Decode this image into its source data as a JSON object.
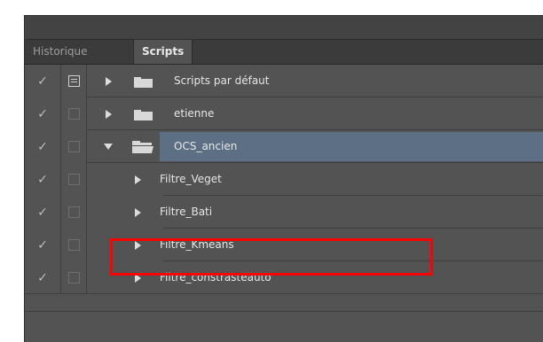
{
  "tabs": [
    {
      "label": "Historique",
      "active": false
    },
    {
      "label": "Scripts",
      "active": true
    }
  ],
  "rows": [
    {
      "type": "folder",
      "label": "Scripts par défaut",
      "checked": true,
      "dialog": true,
      "expanded": false,
      "selected": false
    },
    {
      "type": "folder",
      "label": "etienne",
      "checked": true,
      "dialog": false,
      "expanded": false,
      "selected": false
    },
    {
      "type": "folder",
      "label": "OCS_ancien",
      "checked": true,
      "dialog": false,
      "expanded": true,
      "selected": true
    },
    {
      "type": "action",
      "label": "Filtre_Veget",
      "checked": true,
      "dialog": false,
      "expanded": false,
      "selected": false
    },
    {
      "type": "action",
      "label": "Filtre_Bati",
      "checked": true,
      "dialog": false,
      "expanded": false,
      "selected": false
    },
    {
      "type": "action",
      "label": "Filtre_Kmeans",
      "checked": true,
      "dialog": false,
      "expanded": false,
      "selected": false
    },
    {
      "type": "action",
      "label": "Filtre_constrasteauto",
      "checked": true,
      "dialog": false,
      "expanded": false,
      "selected": false
    }
  ],
  "icons": {
    "check": "check-icon",
    "folder": "folder-icon",
    "open_folder": "open-folder-icon",
    "expand": "triangle-right-icon",
    "collapse": "triangle-down-icon"
  },
  "colors": {
    "panel_bg": "#535353",
    "selection": "#5d6f85",
    "annotation_red": "#ff0000"
  }
}
